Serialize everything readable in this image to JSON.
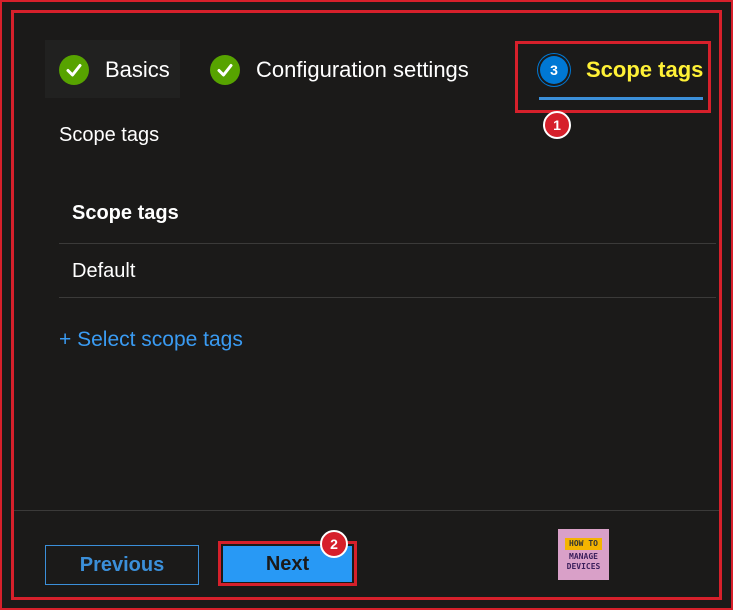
{
  "tabs": [
    {
      "label": "Basics",
      "state": "complete",
      "icon": "check-icon"
    },
    {
      "label": "Configuration settings",
      "state": "complete",
      "icon": "check-icon"
    },
    {
      "label": "Scope tags",
      "state": "active",
      "step": "3"
    }
  ],
  "annotations": {
    "badge1": "1",
    "badge2": "2"
  },
  "section": {
    "title": "Scope tags"
  },
  "table": {
    "header": "Scope tags",
    "rows": [
      "Default"
    ]
  },
  "actions": {
    "select_scope_tags": "+ Select scope tags"
  },
  "footer": {
    "previous_label": "Previous",
    "next_label": "Next"
  },
  "logo": {
    "line1": "HOW TO",
    "line2": "MANAGE",
    "line3": "DEVICES"
  },
  "colors": {
    "accent": "#0078d4",
    "active_tab": "#fff136",
    "complete": "#57a300",
    "highlight": "#d6202b"
  }
}
